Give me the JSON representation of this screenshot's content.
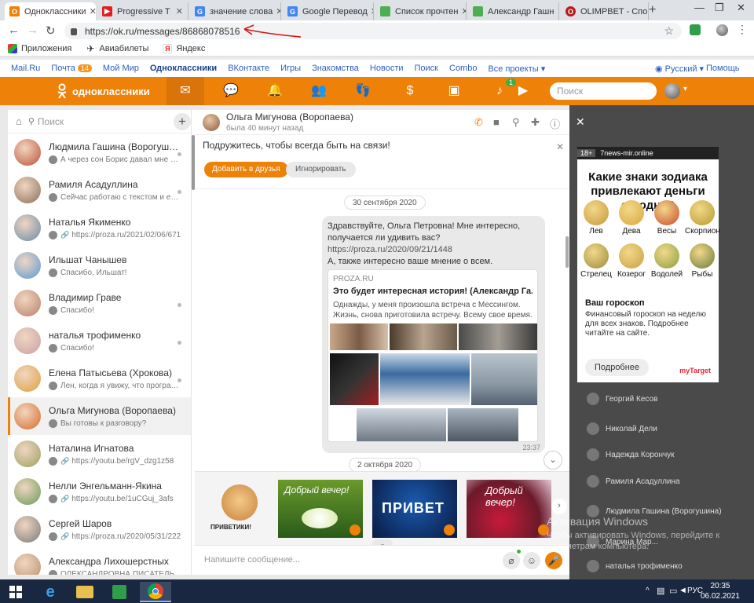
{
  "browser": {
    "tabs": [
      {
        "title": "Одноклассники",
        "color": "#ee8208",
        "glyph": "О",
        "active": true
      },
      {
        "title": "Progressive T",
        "color": "#e02020",
        "glyph": "▶"
      },
      {
        "title": "значение слова",
        "color": "#4285f4",
        "glyph": "G"
      },
      {
        "title": "Google Перевод",
        "color": "#4285f4",
        "glyph": "G"
      },
      {
        "title": "Список прочтен",
        "color": "#4caf50",
        "glyph": ""
      },
      {
        "title": "Александр Гашн",
        "color": "#4caf50",
        "glyph": ""
      },
      {
        "title": "OLIMPBET - Спо",
        "color": "#b71c1c",
        "glyph": "O"
      }
    ],
    "url": "https://ok.ru/messages/86868078516",
    "bookmarks": [
      "Приложения",
      "Авиабилеты",
      "Яндекс"
    ]
  },
  "portal_nav": {
    "items": [
      "Mail.Ru",
      "Почта",
      "Мой Мир",
      "Одноклассники",
      "ВКонтакте",
      "Игры",
      "Знакомства",
      "Новости",
      "Поиск",
      "Combo",
      "Все проекты ▾"
    ],
    "mail_badge": "14",
    "language": "Русский ▾",
    "help": "Помощь"
  },
  "ok_header": {
    "logo_text": "одноклассники",
    "music_badge": "1",
    "search_placeholder": "Поиск"
  },
  "contacts": {
    "search_placeholder": "Поиск",
    "items": [
      {
        "name": "Людмила Гашина (Ворогушина)",
        "preview": "А через сон Борис давал мне по...",
        "avatar": "#c0503a"
      },
      {
        "name": "Рамиля Асадуллина",
        "preview": "Сейчас работаю с текстом и ещ...",
        "avatar": "#8a6e5a"
      },
      {
        "name": "Наталья Якименко",
        "preview": "https://proza.ru/2021/02/06/671",
        "avatar": "#6a8aaa",
        "link": true
      },
      {
        "name": "Ильшат Чанышев",
        "preview": "Спасибо, Ильшат!",
        "avatar": "#5a9ad8"
      },
      {
        "name": "Владимир Граве",
        "preview": "Спасибо!",
        "avatar": "#b8806a"
      },
      {
        "name": "наталья трофименко",
        "preview": "Спасибо!",
        "avatar": "#c8a0a8"
      },
      {
        "name": "Елена Патысьева (Хрокова)",
        "preview": "Лен, когда я увижу, что програм...",
        "avatar": "#e0a040"
      },
      {
        "name": "Ольга Мигунова (Воропаева)",
        "preview": "Вы готовы к разговору?",
        "avatar": "#d86a2a",
        "selected": true
      },
      {
        "name": "Наталина Игнатова",
        "preview": "https://youtu.be/rgV_dzg1z58",
        "avatar": "#9aa060",
        "link": true
      },
      {
        "name": "Нелли Энгельманн-Якина",
        "preview": "https://youtu.be/1uCGuj_3afs",
        "avatar": "#6a9a5a",
        "link": true
      },
      {
        "name": "Сергей Шаров",
        "preview": "https://proza.ru/2020/05/31/222",
        "avatar": "#7a7a7a",
        "link": true
      },
      {
        "name": "Александра Лихошерстных",
        "preview": "ОЛЕКСАНДРОВНА ПИСАТЕЛЬ",
        "avatar": "#b89070"
      }
    ]
  },
  "chat": {
    "name": "Ольга Мигунова (Воропаева)",
    "status": "была 40 минут назад",
    "friend_prompt": "Подружитесь, чтобы всегда быть на связи!",
    "add_friend": "Добавить в друзья",
    "ignore": "Игнорировать",
    "date1": "30 сентября 2020",
    "date2": "2 октября 2020",
    "message": {
      "line1": "Здравствуйте, Ольга Петровна! Мне интересно,",
      "line2": "получается ли удивить вас?",
      "link": "https://proza.ru/2020/09/21/1448",
      "line3": "А, также интересно ваше мнение о всем.",
      "time": "23:37"
    },
    "card": {
      "domain": "PROZA.RU",
      "title": "Это будет интересная история! (Александр Га...",
      "desc": "Однажды, у меня произошла встреча с Мессингом. Жизнь, снова приготовила встречу. Всему свое время. Написано ..."
    },
    "stickers": [
      "ПРИВЕТИКИ!",
      "Добрый вечер!",
      "ПРИВЕТ",
      "Добрый вечер!"
    ],
    "composer_placeholder": "Напишите сообщение..."
  },
  "ad": {
    "age": "18+",
    "source": "7news-mir.online",
    "title": "Какие знаки зодиака привлекают деньги сегодня?",
    "signs": [
      "Лев",
      "Дева",
      "Весы",
      "Скорпион",
      "Стрелец",
      "Козерог",
      "Водолей",
      "Рыбы"
    ],
    "heading": "Ваш гороскоп",
    "text": "Финансовый гороскоп на неделю для всех знаков. Подробнее читайте на сайте.",
    "button": "Подробнее",
    "logo": "myTarget"
  },
  "right_friends": [
    "Георгий Кесов",
    "Николай Дели",
    "Надежда Корончук",
    "Рамиля Асадуллина",
    "Людмила Гашина (Ворогушина)",
    "Марина Мар...",
    "наталья трофименко"
  ],
  "watermark": {
    "title": "Активация Windows",
    "text": "Чтобы активировать Windows, перейдите к параметрам компьютера."
  },
  "taskbar": {
    "lang": "РУС",
    "time": "20:35",
    "date": "06.02.2021"
  }
}
